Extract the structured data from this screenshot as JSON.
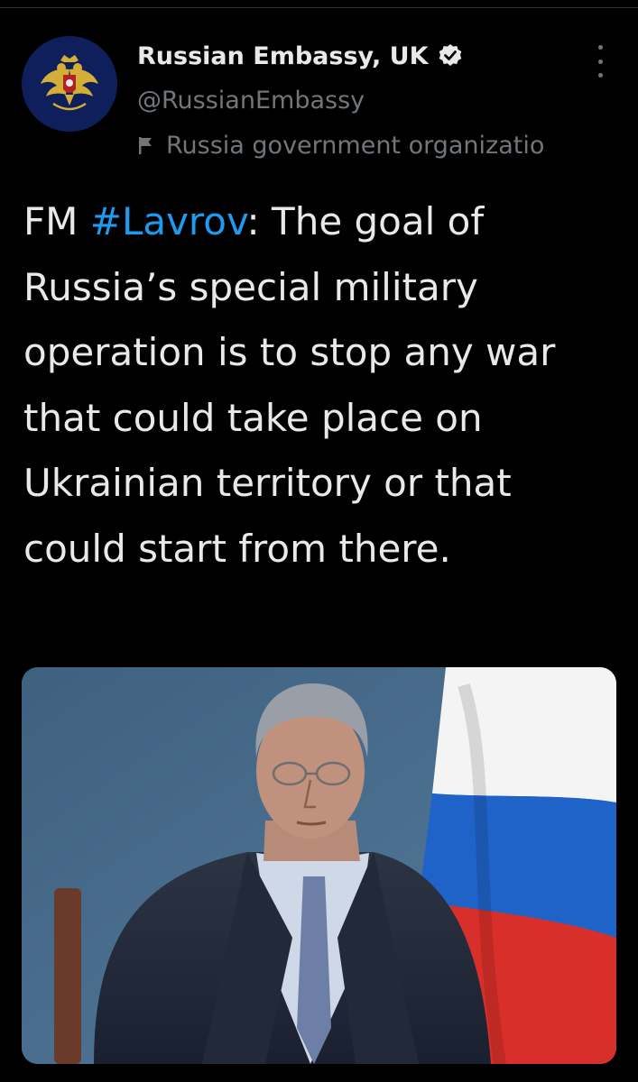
{
  "account": {
    "display_name": "Russian Embassy, UK",
    "handle": "@RussianEmbassy",
    "label": "Russia government organizatio",
    "verified": true,
    "avatar_icon": "double-headed-eagle-emblem",
    "verified_icon": "verified-badge-icon",
    "label_icon": "flag-icon",
    "more_icon": "more-options-icon"
  },
  "tweet": {
    "prefix": "FM ",
    "hashtag": "#Lavrov",
    "body": ": The goal of Russia’s special military operation is to stop any war that could take place on Ukrainian territory or that could start from there."
  },
  "media": {
    "subject": "photo-of-man-in-suit-beside-russian-flag"
  },
  "colors": {
    "background": "#000000",
    "text_primary": "#e7e9ea",
    "text_secondary": "#71767b",
    "hashtag": "#1d9bf0",
    "avatar_bg": "#0f1f5c"
  }
}
